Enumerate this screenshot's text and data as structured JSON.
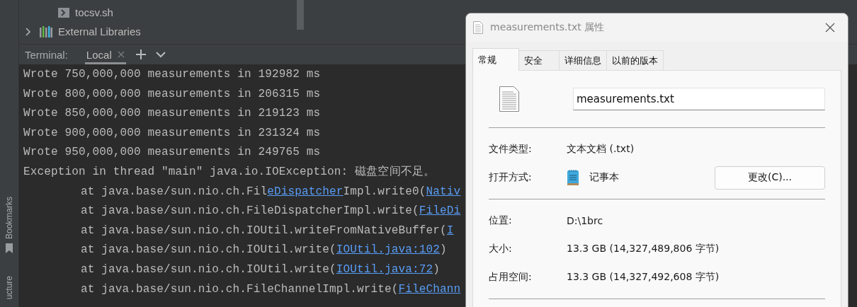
{
  "project_tree": {
    "files": [
      {
        "name": "tocsv.sh"
      }
    ],
    "external_libraries": {
      "label": "External Libraries",
      "expanded": false
    }
  },
  "tool_strip": [
    {
      "label": "Bookmarks",
      "kind": "bookmarks"
    },
    {
      "label": "ucture",
      "kind": "structure"
    }
  ],
  "terminal": {
    "label": "Terminal:",
    "tabs": [
      {
        "label": "Local",
        "selected": true
      }
    ],
    "lines": [
      {
        "kind": "output",
        "parts": [
          {
            "text": "Wrote 750,000,000 measurements in 192982 ms",
            "link": false
          }
        ]
      },
      {
        "kind": "output",
        "parts": [
          {
            "text": "Wrote 800,000,000 measurements in 206315 ms",
            "link": false
          }
        ]
      },
      {
        "kind": "output",
        "parts": [
          {
            "text": "Wrote 850,000,000 measurements in 219123 ms",
            "link": false
          }
        ]
      },
      {
        "kind": "output",
        "parts": [
          {
            "text": "Wrote 900,000,000 measurements in 231324 ms",
            "link": false
          }
        ]
      },
      {
        "kind": "output",
        "parts": [
          {
            "text": "Wrote 950,000,000 measurements in 249765 ms",
            "link": false
          }
        ]
      },
      {
        "kind": "output",
        "parts": [
          {
            "text": "Exception in thread \"main\" java.io.IOException: 磁盘空间不足。",
            "link": false
          }
        ]
      },
      {
        "kind": "trace",
        "parts": [
          {
            "text": "at java.base/sun.nio.ch.Fil",
            "link": false
          },
          {
            "text": "eDispatcher",
            "link": true
          },
          {
            "text": "Impl.write0(",
            "link": false
          },
          {
            "text": "Nativ",
            "link": true
          }
        ]
      },
      {
        "kind": "trace",
        "parts": [
          {
            "text": "at java.base/sun.nio.ch.FileDispatcherImpl.write(",
            "link": false
          },
          {
            "text": "FileDi",
            "link": true
          }
        ]
      },
      {
        "kind": "trace",
        "parts": [
          {
            "text": "at java.base/sun.nio.ch.IOUtil.writeFromNativeBuffer(",
            "link": false
          },
          {
            "text": "I",
            "link": true
          }
        ]
      },
      {
        "kind": "trace",
        "parts": [
          {
            "text": "at java.base/sun.nio.ch.IOUtil.write(",
            "link": false
          },
          {
            "text": "IOUtil.java:102",
            "link": true
          },
          {
            "text": ")",
            "link": false
          }
        ]
      },
      {
        "kind": "trace",
        "parts": [
          {
            "text": "at java.base/sun.nio.ch.IOUtil.write(",
            "link": false
          },
          {
            "text": "IOUtil.java:72",
            "link": true
          },
          {
            "text": ")",
            "link": false
          }
        ]
      },
      {
        "kind": "trace",
        "parts": [
          {
            "text": "at java.base/sun.nio.ch.FileChannelImpl.write(",
            "link": false
          },
          {
            "text": "FileChann",
            "link": true
          }
        ]
      }
    ]
  },
  "properties_dialog": {
    "title": "measurements.txt 属性",
    "tabs": [
      {
        "label": "常规",
        "selected": true
      },
      {
        "label": "安全",
        "selected": false
      },
      {
        "label": "详细信息",
        "selected": false
      },
      {
        "label": "以前的版本",
        "selected": false
      }
    ],
    "file_name": "measurements.txt",
    "sections": [
      [
        {
          "kind": "text",
          "label": "文件类型:",
          "value": "文本文档 (.txt)"
        },
        {
          "kind": "app",
          "label": "打开方式:",
          "value": "记事本",
          "button": "更改(C)..."
        }
      ],
      [
        {
          "kind": "text",
          "label": "位置:",
          "value": "D:\\1brc"
        },
        {
          "kind": "text",
          "label": "大小:",
          "value": "13.3 GB (14,327,489,806 字节)"
        },
        {
          "kind": "text",
          "label": "占用空间:",
          "value": "13.3 GB (14,327,492,608 字节)"
        }
      ]
    ]
  }
}
